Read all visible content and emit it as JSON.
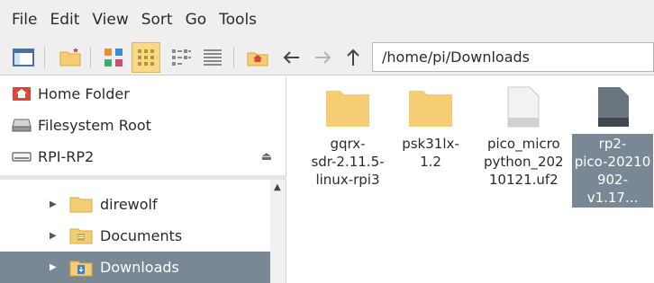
{
  "menu": [
    "File",
    "Edit",
    "View",
    "Sort",
    "Go",
    "Tools"
  ],
  "toolbar": {
    "path": "/home/pi/Downloads",
    "icons": [
      "sidebar-toggle-icon",
      "new-folder-icon",
      "icon-view-icon",
      "thumbnail-view-icon",
      "compact-view-icon",
      "list-view-icon",
      "home-icon",
      "back-arrow-icon",
      "forward-arrow-icon",
      "up-arrow-icon"
    ]
  },
  "places": [
    {
      "label": "Home Folder",
      "icon": "home-folder-icon"
    },
    {
      "label": "Filesystem Root",
      "icon": "drive-icon"
    },
    {
      "label": "RPI-RP2",
      "icon": "drive-icon",
      "eject": "⏏"
    }
  ],
  "tree": [
    {
      "label": "direwolf",
      "selected": false
    },
    {
      "label": "Documents",
      "selected": false
    },
    {
      "label": "Downloads",
      "selected": true
    }
  ],
  "files": [
    {
      "label_lines": [
        "gqrx-",
        "sdr-2.11.5-",
        "linux-rpi3"
      ],
      "type": "folder",
      "selected": false
    },
    {
      "label_lines": [
        "psk31lx-1.2"
      ],
      "type": "folder",
      "selected": false
    },
    {
      "label_lines": [
        "pico_micro",
        "python_202",
        "10121.uf2"
      ],
      "type": "file",
      "selected": false
    },
    {
      "label_lines": [
        "rp2-",
        "pico-20210",
        "902-v1.17..."
      ],
      "type": "file",
      "selected": true
    }
  ],
  "colors": {
    "selection": "#7a8795",
    "folder": "#f5cd74",
    "chrome": "#efefef",
    "home_red": "#d9473b"
  }
}
